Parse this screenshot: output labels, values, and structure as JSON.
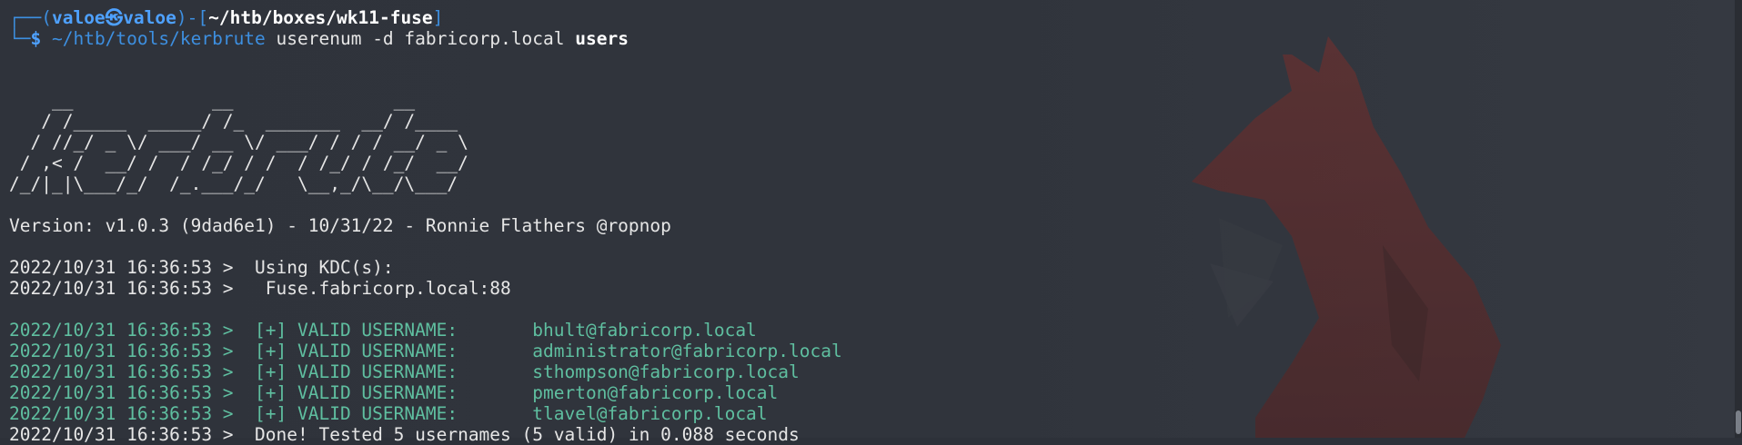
{
  "prompt": {
    "user": "valoe",
    "at_glyph": "㉿",
    "host": "valoe",
    "cwd": "~/htb/boxes/wk11-fuse",
    "corner_top": "┌──(",
    "mid": ")-[",
    "close": "]",
    "corner_bottom": "└─",
    "dollar": "$"
  },
  "command": {
    "exe": "~/htb/tools/kerbrute",
    "args": " userenum -d fabricorp.local ",
    "file": "users"
  },
  "banner_ascii": "    __             __               __     \n   / /_____  _____/ /_  _______  __/ /____ \n  / //_/ _ \\/ ___/ __ \\/ ___/ / / / __/ _ \\\n / ,< /  __/ /  / /_/ / /  / /_/ / /_/  __/\n/_/|_|\\___/_/  /_.___/_/   \\__,_/\\__/\\___/ ",
  "version_line": "Version: v1.0.3 (9dad6e1) - 10/31/22 - Ronnie Flathers @ropnop",
  "kdc_lines": [
    "2022/10/31 16:36:53 >  Using KDC(s):",
    "2022/10/31 16:36:53 >   Fuse.fabricorp.local:88"
  ],
  "valid_lines": [
    "2022/10/31 16:36:53 >  [+] VALID USERNAME:       bhult@fabricorp.local",
    "2022/10/31 16:36:53 >  [+] VALID USERNAME:       administrator@fabricorp.local",
    "2022/10/31 16:36:53 >  [+] VALID USERNAME:       sthompson@fabricorp.local",
    "2022/10/31 16:36:53 >  [+] VALID USERNAME:       pmerton@fabricorp.local",
    "2022/10/31 16:36:53 >  [+] VALID USERNAME:       tlavel@fabricorp.local"
  ],
  "done_line": "2022/10/31 16:36:53 >  Done! Tested 5 usernames (5 valid) in 0.088 seconds",
  "colors": {
    "background": "#2f333b",
    "prompt_blue": "#3d8fe0",
    "valid_green": "#5fbfa0",
    "fox_red": "#7a2f2c"
  },
  "icons": {
    "wallpaper": "fox-silhouette-icon"
  }
}
